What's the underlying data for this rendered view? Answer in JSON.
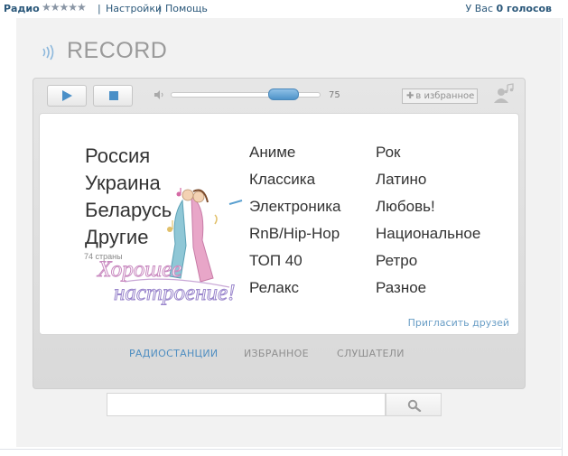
{
  "topbar": {
    "app_title": "Радио",
    "rating_stars": "★★★★★",
    "settings_link": "Настройки",
    "help_link": "Помощь",
    "voices_prefix": "У Вас",
    "voices_count": "0 голосов"
  },
  "station": {
    "name": "RECORD",
    "signal_icon": "radio-signal-icon"
  },
  "player": {
    "play_icon": "play-icon",
    "stop_icon": "stop-icon",
    "volume_icon": "speaker-icon",
    "volume": 75,
    "volume_label": "75",
    "favorite_label": "в избранное",
    "listener_icon": "user-music-icon"
  },
  "regions": {
    "items": [
      "Россия",
      "Украина",
      "Беларусь",
      "Другие"
    ],
    "others_count": "74 страны"
  },
  "genres": {
    "column_a": [
      "Аниме",
      "Классика",
      "Электроника",
      "RnB/Hip-Hop",
      "ТОП 40",
      "Релакс"
    ],
    "column_b": [
      "Рок",
      "Латино",
      "Любовь!",
      "Национальное",
      "Ретро",
      "Разное"
    ]
  },
  "promo": {
    "text_line1": "Хорошее",
    "text_line2": "настроение!"
  },
  "invite_link": "Пригласить друзей",
  "tabs": [
    "РАДИОСТАНЦИИ",
    "ИЗБРАННОЕ",
    "СЛУШАТЕЛИ"
  ],
  "search": {
    "placeholder": "",
    "icon": "search-icon"
  },
  "colors": {
    "accent_blue": "#4a8fc7",
    "link_blue": "#2b587a",
    "tab_active": "#4f8ec1",
    "promo_pink": "#d56aa5"
  }
}
